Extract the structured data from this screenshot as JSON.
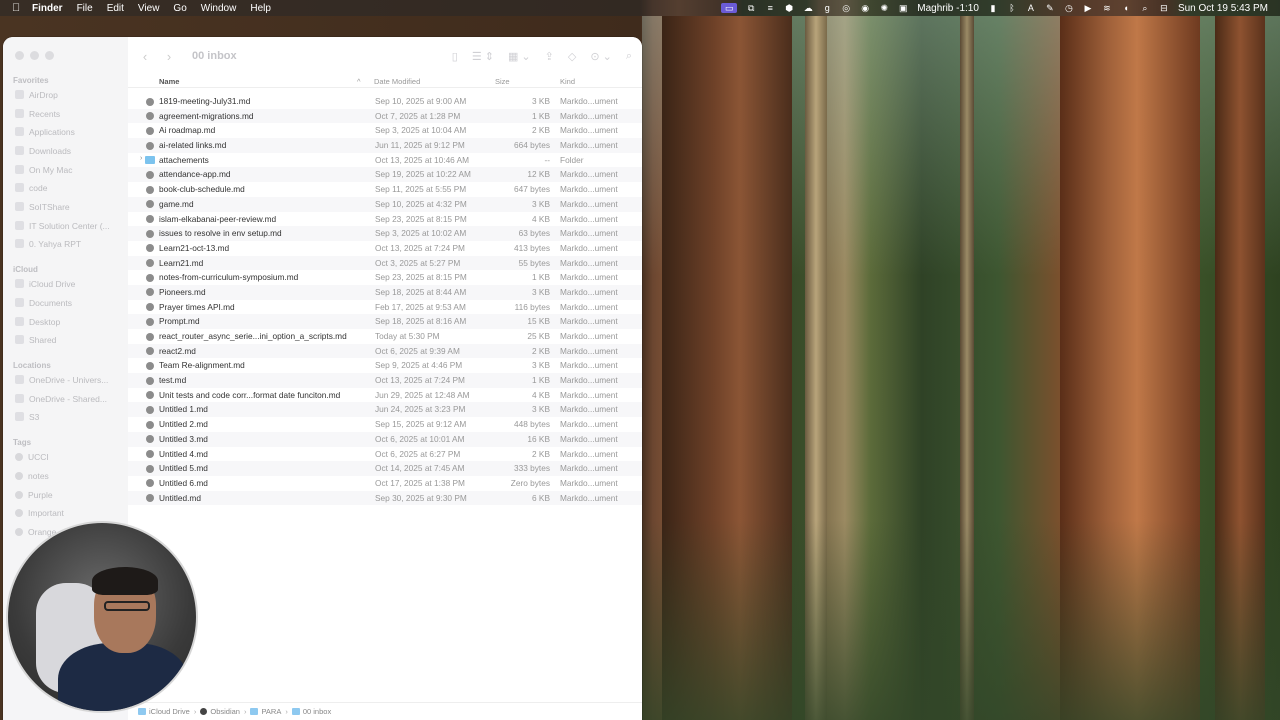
{
  "menubar": {
    "app": "Finder",
    "items": [
      "File",
      "Edit",
      "View",
      "Go",
      "Window",
      "Help"
    ],
    "input_source": "Maghrib -1:10",
    "clock": "Sun Oct 19  5:43 PM"
  },
  "window": {
    "title": "00 inbox"
  },
  "sidebar": {
    "favorites_header": "Favorites",
    "favorites": [
      "AirDrop",
      "Recents",
      "Applications",
      "Downloads",
      "On My Mac",
      "code",
      "SoITShare",
      "IT Solution Center (...",
      "0. Yahya RPT"
    ],
    "icloud_header": "iCloud",
    "icloud": [
      "iCloud Drive",
      "Documents",
      "Desktop",
      "Shared"
    ],
    "locations_header": "Locations",
    "locations": [
      "OneDrive - Univers...",
      "OneDrive - Shared...",
      "S3"
    ],
    "tags_header": "Tags",
    "tags": [
      "UCCI",
      "notes",
      "Purple",
      "Important",
      "Orange"
    ]
  },
  "columns": {
    "name": "Name",
    "date": "Date Modified",
    "size": "Size",
    "kind": "Kind"
  },
  "files": [
    {
      "name": "1819-meeting-July31.md",
      "date": "Sep 10, 2025 at 9:00 AM",
      "size": "3 KB",
      "kind": "Markdo...ument"
    },
    {
      "name": "agreement-migrations.md",
      "date": "Oct 7, 2025 at 1:28 PM",
      "size": "1 KB",
      "kind": "Markdo...ument"
    },
    {
      "name": "Ai roadmap.md",
      "date": "Sep 3, 2025 at 10:04 AM",
      "size": "2 KB",
      "kind": "Markdo...ument"
    },
    {
      "name": "ai-related links.md",
      "date": "Jun 11, 2025 at 9:12 PM",
      "size": "664 bytes",
      "kind": "Markdo...ument"
    },
    {
      "name": "attachements",
      "date": "Oct 13, 2025 at 10:46 AM",
      "size": "--",
      "kind": "Folder"
    },
    {
      "name": "attendance-app.md",
      "date": "Sep 19, 2025 at 10:22 AM",
      "size": "12 KB",
      "kind": "Markdo...ument"
    },
    {
      "name": "book-club-schedule.md",
      "date": "Sep 11, 2025 at 5:55 PM",
      "size": "647 bytes",
      "kind": "Markdo...ument"
    },
    {
      "name": "game.md",
      "date": "Sep 10, 2025 at 4:32 PM",
      "size": "3 KB",
      "kind": "Markdo...ument"
    },
    {
      "name": "islam-elkabanai-peer-review.md",
      "date": "Sep 23, 2025 at 8:15 PM",
      "size": "4 KB",
      "kind": "Markdo...ument"
    },
    {
      "name": "issues to resolve in env setup.md",
      "date": "Sep 3, 2025 at 10:02 AM",
      "size": "63 bytes",
      "kind": "Markdo...ument"
    },
    {
      "name": "Learn21-oct-13.md",
      "date": "Oct 13, 2025 at 7:24 PM",
      "size": "413 bytes",
      "kind": "Markdo...ument"
    },
    {
      "name": "Learn21.md",
      "date": "Oct 3, 2025 at 5:27 PM",
      "size": "55 bytes",
      "kind": "Markdo...ument"
    },
    {
      "name": "notes-from-curriculum-symposium.md",
      "date": "Sep 23, 2025 at 8:15 PM",
      "size": "1 KB",
      "kind": "Markdo...ument"
    },
    {
      "name": "Pioneers.md",
      "date": "Sep 18, 2025 at 8:44 AM",
      "size": "3 KB",
      "kind": "Markdo...ument"
    },
    {
      "name": "Prayer times API.md",
      "date": "Feb 17, 2025 at 9:53 AM",
      "size": "116 bytes",
      "kind": "Markdo...ument"
    },
    {
      "name": "Prompt.md",
      "date": "Sep 18, 2025 at 8:16 AM",
      "size": "15 KB",
      "kind": "Markdo...ument"
    },
    {
      "name": "react_router_async_serie...ini_option_a_scripts.md",
      "date": "Today at 5:30 PM",
      "size": "25 KB",
      "kind": "Markdo...ument"
    },
    {
      "name": "react2.md",
      "date": "Oct 6, 2025 at 9:39 AM",
      "size": "2 KB",
      "kind": "Markdo...ument"
    },
    {
      "name": "Team Re-alignment.md",
      "date": "Sep 9, 2025 at 4:46 PM",
      "size": "3 KB",
      "kind": "Markdo...ument"
    },
    {
      "name": "test.md",
      "date": "Oct 13, 2025 at 7:24 PM",
      "size": "1 KB",
      "kind": "Markdo...ument"
    },
    {
      "name": "Unit tests and code corr...format date funciton.md",
      "date": "Jun 29, 2025 at 12:48 AM",
      "size": "4 KB",
      "kind": "Markdo...ument"
    },
    {
      "name": "Untitled 1.md",
      "date": "Jun 24, 2025 at 3:23 PM",
      "size": "3 KB",
      "kind": "Markdo...ument"
    },
    {
      "name": "Untitled 2.md",
      "date": "Sep 15, 2025 at 9:12 AM",
      "size": "448 bytes",
      "kind": "Markdo...ument"
    },
    {
      "name": "Untitled 3.md",
      "date": "Oct 6, 2025 at 10:01 AM",
      "size": "16 KB",
      "kind": "Markdo...ument"
    },
    {
      "name": "Untitled 4.md",
      "date": "Oct 6, 2025 at 6:27 PM",
      "size": "2 KB",
      "kind": "Markdo...ument"
    },
    {
      "name": "Untitled 5.md",
      "date": "Oct 14, 2025 at 7:45 AM",
      "size": "333 bytes",
      "kind": "Markdo...ument"
    },
    {
      "name": "Untitled 6.md",
      "date": "Oct 17, 2025 at 1:38 PM",
      "size": "Zero bytes",
      "kind": "Markdo...ument"
    },
    {
      "name": "Untitled.md",
      "date": "Sep 30, 2025 at 9:30 PM",
      "size": "6 KB",
      "kind": "Markdo...ument"
    }
  ],
  "pathbar": [
    "iCloud Drive",
    "Obsidian",
    "PARA",
    "00 inbox"
  ],
  "colors": {
    "folder": "#7cc3ee",
    "menubar_active": "#6b5bd6"
  }
}
